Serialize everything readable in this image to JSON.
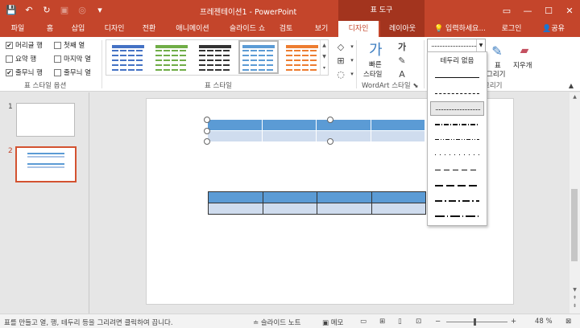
{
  "titlebar": {
    "doc_title": "프레젠테이션1 - PowerPoint",
    "tool_tab_group": "표 도구"
  },
  "tabs": [
    "파일",
    "홈",
    "삽입",
    "디자인",
    "전환",
    "애니메이션",
    "슬라이드 쇼",
    "검토",
    "보기",
    "디자인",
    "레이아웃"
  ],
  "tell_me": "입력하세요...",
  "signin": "로그인",
  "share": "공유",
  "style_options": {
    "items": [
      {
        "label": "머리글 행",
        "checked": true
      },
      {
        "label": "첫째 열",
        "checked": false
      },
      {
        "label": "요약 행",
        "checked": false
      },
      {
        "label": "마지막 열",
        "checked": false
      },
      {
        "label": "줄무늬 행",
        "checked": true
      },
      {
        "label": "줄무늬 열",
        "checked": false
      }
    ],
    "group_label": "표 스타일 옵션"
  },
  "table_styles": {
    "group_label": "표 스타일",
    "colors": [
      "#4472c4",
      "#70ad47",
      "#333333",
      "#5b9bd5",
      "#ed7d31"
    ]
  },
  "wordart": {
    "quick_label_1": "빠른",
    "quick_label_2": "스타일",
    "group_label": "WordArt 스타일",
    "glyph": "가"
  },
  "draw_borders": {
    "draw_table_1": "표",
    "draw_table_2": "그리기",
    "eraser": "지우개",
    "group_label": "그리기"
  },
  "pen_dropdown": {
    "none_label": "테두리 없음"
  },
  "slides": [
    "1",
    "2"
  ],
  "status": {
    "message": "표를 만들고 열, 행, 테두리 등을 그리려면 클릭하여 끕니다.",
    "notes": "슬라이드 노트",
    "comments": "메모",
    "zoom": "48 %"
  }
}
